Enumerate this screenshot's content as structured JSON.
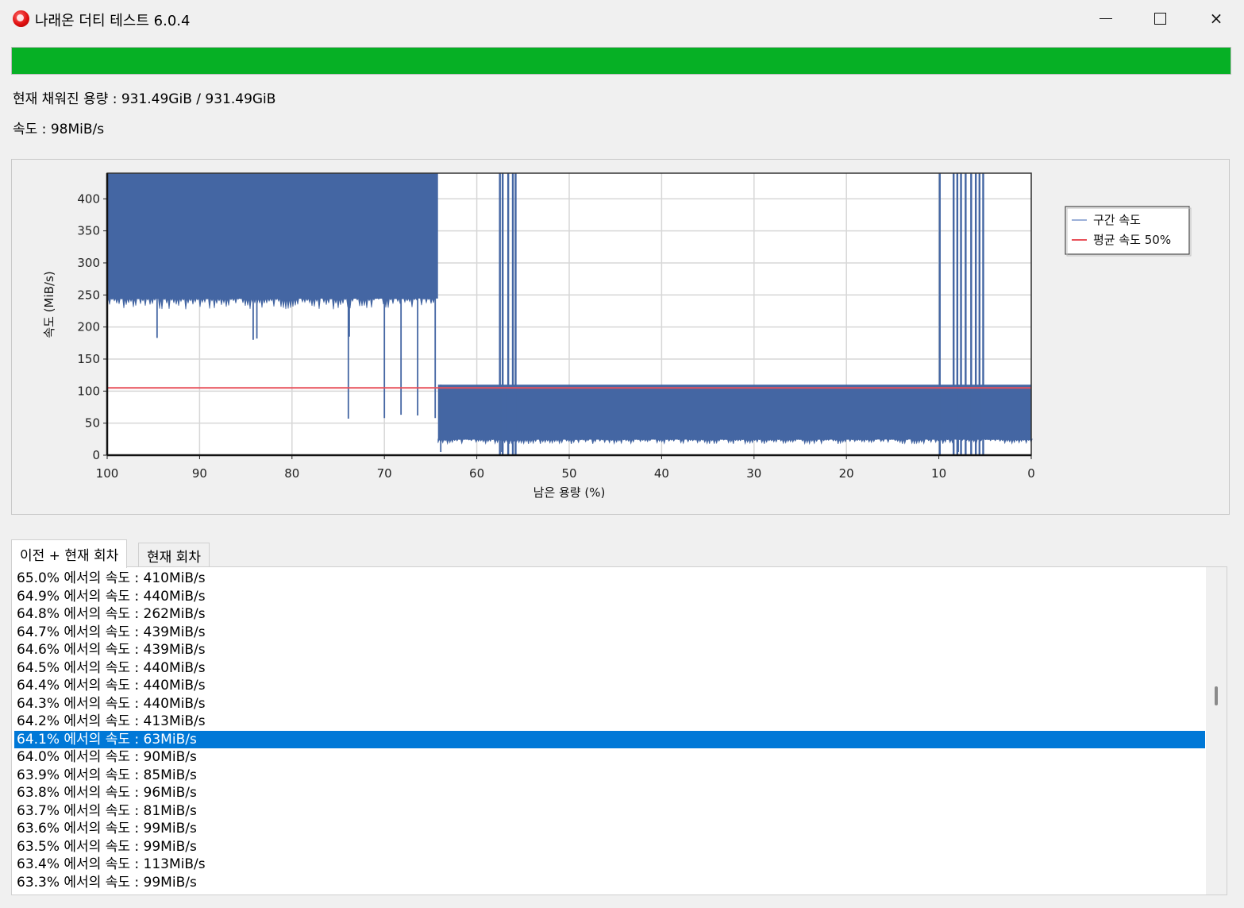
{
  "window": {
    "title": "나래온 더티 테스트 6.0.4",
    "icon": "app-logo-icon",
    "controls": {
      "minimize": "minimize-icon",
      "maximize": "maximize-icon",
      "close": "×"
    }
  },
  "progress": {
    "percent": 100,
    "color": "#06b025"
  },
  "status": {
    "filled": "현재 채워진 용량 : 931.49GiB / 931.49GiB",
    "speed": "속도 : 98MiB/s"
  },
  "chart_data": {
    "type": "area",
    "xlabel": "남은 용량 (%)",
    "ylabel": "속도 (MiB/s)",
    "xlim": [
      100,
      0
    ],
    "ylim": [
      0,
      440
    ],
    "xticks": [
      "100",
      "90",
      "80",
      "70",
      "60",
      "50",
      "40",
      "30",
      "20",
      "10",
      "0"
    ],
    "yticks": [
      "0",
      "50",
      "100",
      "150",
      "200",
      "250",
      "300",
      "350",
      "400"
    ],
    "grid": true,
    "legend_position": "right",
    "series": [
      {
        "name": "구간 속도",
        "color": "#4466a3",
        "segments": [
          {
            "x_from": 100,
            "x_to": 64.2,
            "low": 245,
            "high": 440
          },
          {
            "x_from": 64.2,
            "x_to": 0,
            "low": 25,
            "high": 110
          }
        ],
        "spikes_up": [
          57.5,
          57.2,
          56.6,
          56.1,
          55.8,
          9.9,
          8.4,
          8.0,
          7.6,
          7.1,
          6.5,
          6.0,
          5.6,
          5.2
        ],
        "dips": [
          {
            "x": 94.6,
            "y": 183
          },
          {
            "x": 84.2,
            "y": 180
          },
          {
            "x": 83.8,
            "y": 182
          },
          {
            "x": 73.8,
            "y": 185
          },
          {
            "x": 73.9,
            "y": 57
          },
          {
            "x": 70.0,
            "y": 58
          },
          {
            "x": 68.2,
            "y": 63
          },
          {
            "x": 66.4,
            "y": 62
          },
          {
            "x": 64.5,
            "y": 58
          },
          {
            "x": 63.9,
            "y": 5
          },
          {
            "x": 57.3,
            "y": 5
          },
          {
            "x": 7.9,
            "y": 5
          }
        ]
      },
      {
        "name": "평균 속도 50%",
        "color": "#e8505a",
        "value": 105
      }
    ]
  },
  "tabs": [
    {
      "label": "이전 + 현재 회차",
      "active": true
    },
    {
      "label": "현재 회차",
      "active": false
    }
  ],
  "log": {
    "selected_index": 9,
    "items": [
      "65.0% 에서의 속도 : 410MiB/s",
      "64.9% 에서의 속도 : 440MiB/s",
      "64.8% 에서의 속도 : 262MiB/s",
      "64.7% 에서의 속도 : 439MiB/s",
      "64.6% 에서의 속도 : 439MiB/s",
      "64.5% 에서의 속도 : 440MiB/s",
      "64.4% 에서의 속도 : 440MiB/s",
      "64.3% 에서의 속도 : 440MiB/s",
      "64.2% 에서의 속도 : 413MiB/s",
      "64.1% 에서의 속도 : 63MiB/s",
      "64.0% 에서의 속도 : 90MiB/s",
      "63.9% 에서의 속도 : 85MiB/s",
      "63.8% 에서의 속도 : 96MiB/s",
      "63.7% 에서의 속도 : 81MiB/s",
      "63.6% 에서의 속도 : 99MiB/s",
      "63.5% 에서의 속도 : 99MiB/s",
      "63.4% 에서의 속도 : 113MiB/s",
      "63.3% 에서의 속도 : 99MiB/s"
    ]
  }
}
